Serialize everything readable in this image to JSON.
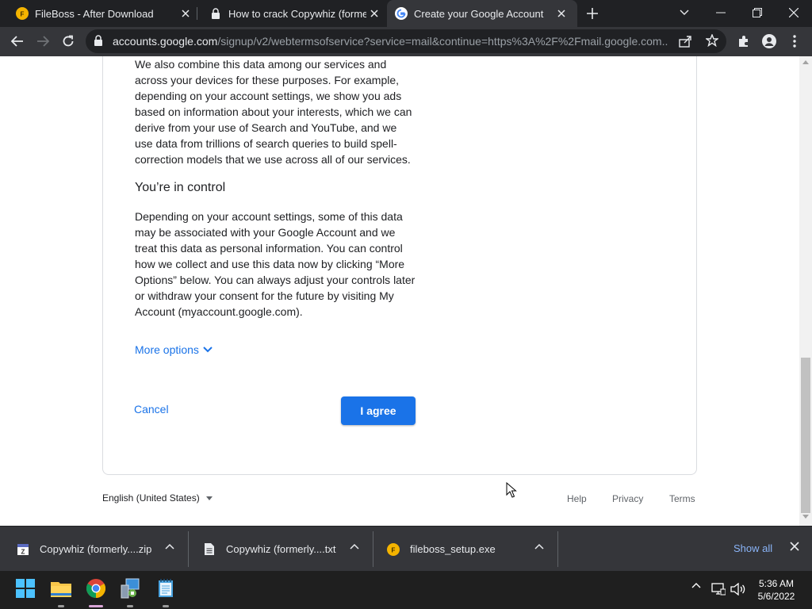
{
  "browser": {
    "tabs": [
      {
        "title": "FileBoss - After Download",
        "icon": "fileboss-logo-icon"
      },
      {
        "title": "How to crack Copywhiz (formerly",
        "icon": "lock-icon"
      },
      {
        "title": "Create your Google Account",
        "icon": "google-logo-icon",
        "active": true
      }
    ],
    "url_host": "accounts.google.com",
    "url_path": "/signup/v2/webtermsofservice?service=mail&continue=https%3A%2F%2Fmail.google.com..."
  },
  "page": {
    "para1": "We also combine this data among our services and across your devices for these purposes. For example, depending on your account settings, we show you ads based on information about your interests, which we can derive from your use of Search and YouTube, and we use data from trillions of search queries to build spell-correction models that we use across all of our services.",
    "heading": "You’re in control",
    "para2": "Depending on your account settings, some of this data may be associated with your Google Account and we treat this data as personal information. You can control how we collect and use this data now by clicking “More Options” below. You can always adjust your controls later or withdraw your consent for the future by visiting My Account (myaccount.google.com).",
    "more_options": "More options",
    "cancel": "Cancel",
    "agree": "I agree",
    "language": "English (United States)",
    "footer_links": [
      "Help",
      "Privacy",
      "Terms"
    ]
  },
  "downloads": {
    "items": [
      {
        "name": "Copywhiz (formerly....zip",
        "icon": "zip-file-icon"
      },
      {
        "name": "Copywhiz (formerly....txt",
        "icon": "text-file-icon"
      },
      {
        "name": "fileboss_setup.exe",
        "icon": "fileboss-logo-icon"
      }
    ],
    "show_all": "Show all"
  },
  "taskbar": {
    "time": "5:36 AM",
    "date": "5/6/2022"
  },
  "colors": {
    "accent": "#1a73e8",
    "chrome_dark": "#202124",
    "chrome_toolbar": "#35363a"
  }
}
